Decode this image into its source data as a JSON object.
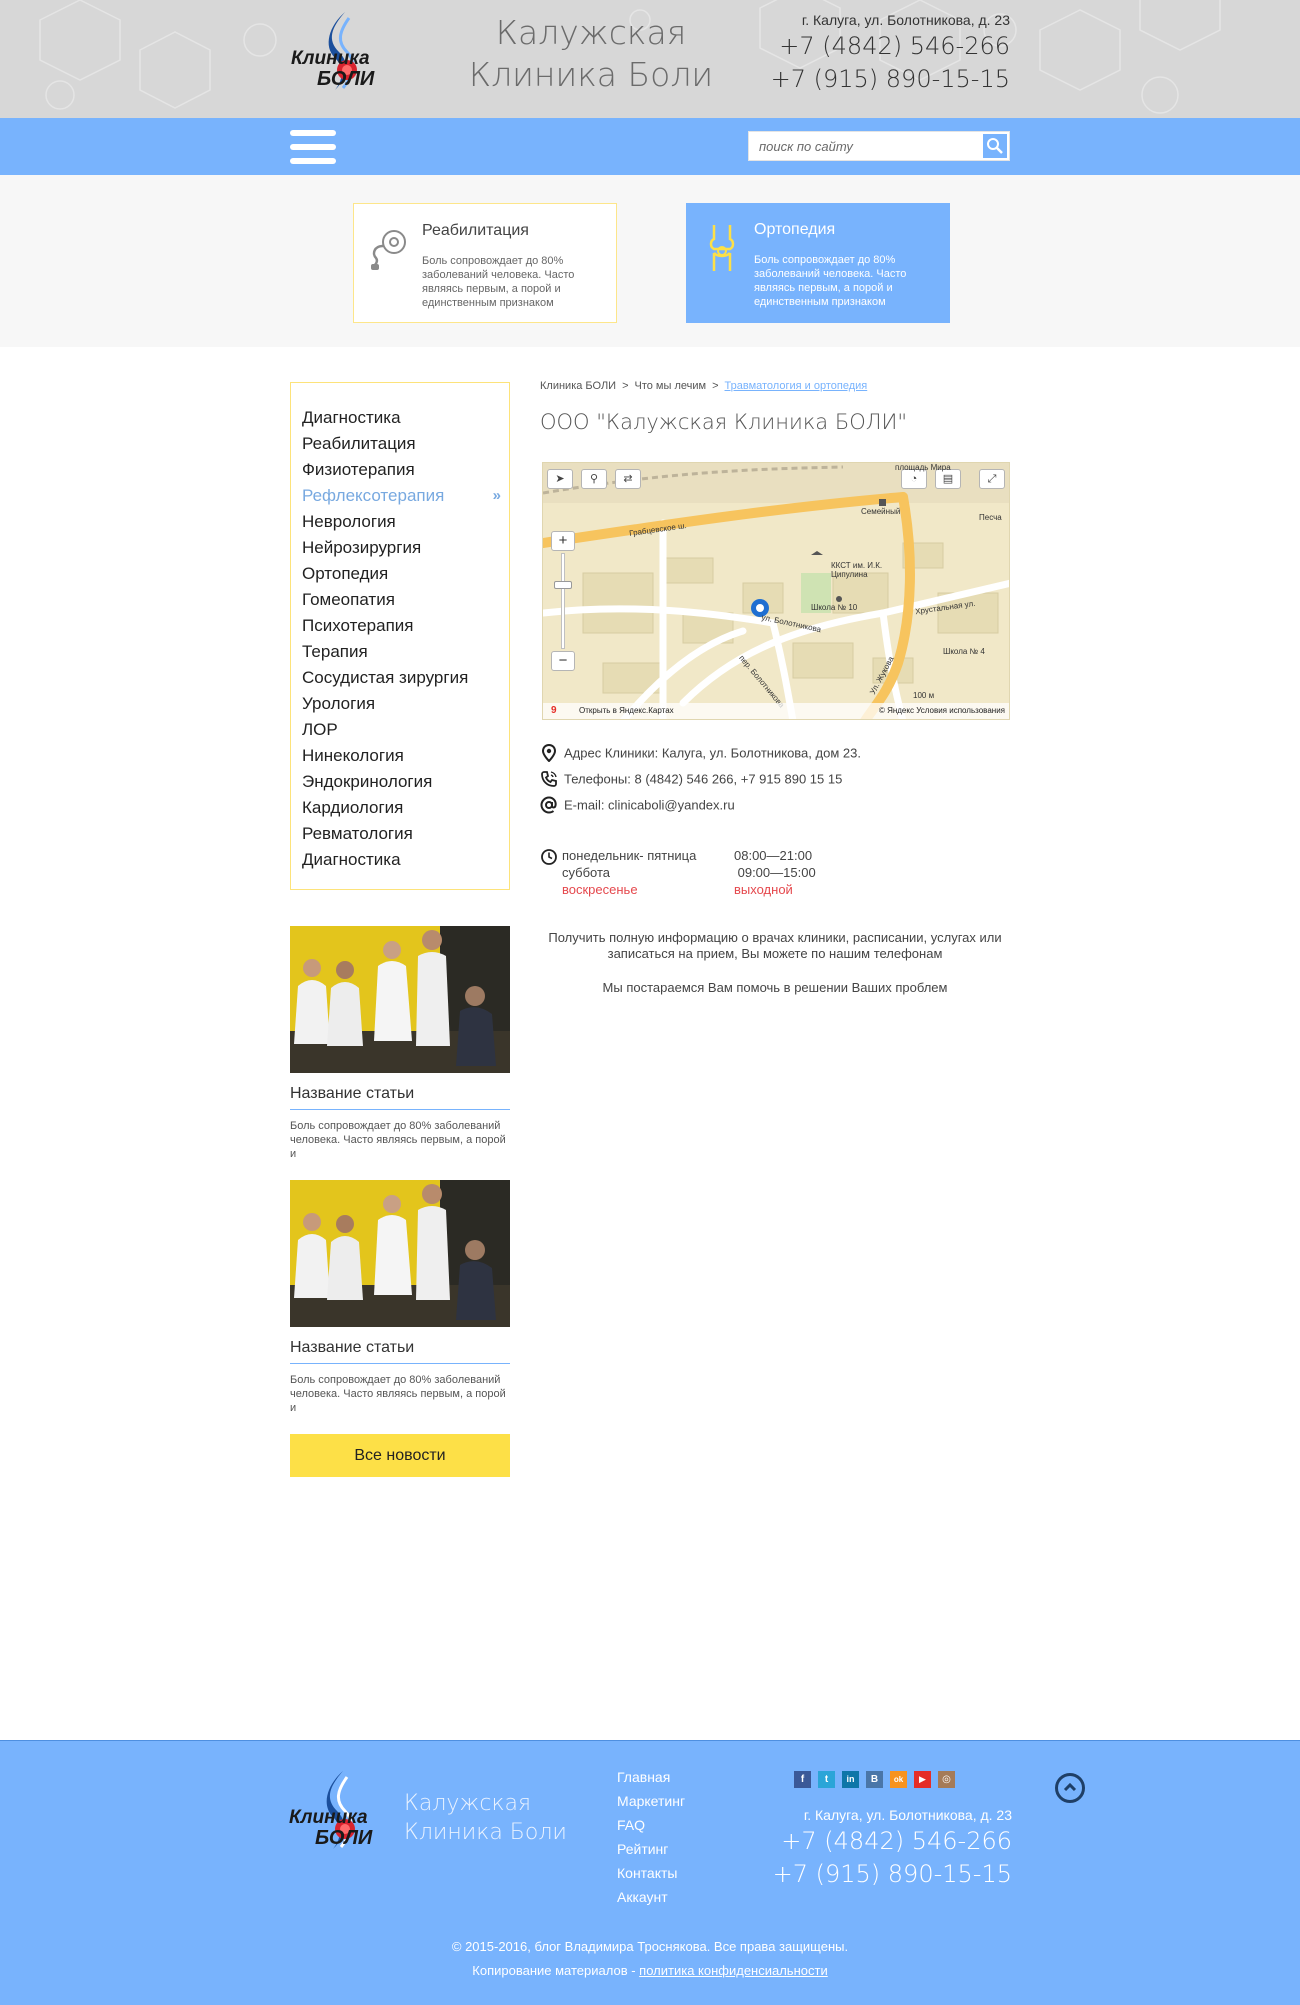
{
  "brand": {
    "logo_line1": "Клиника",
    "logo_line2": "БОЛИ",
    "title_line1": "Калужская",
    "title_line2": "Клиника Боли"
  },
  "header": {
    "address": "г. Калуга, ул. Болотникова, д. 23",
    "phone1": "+7 (4842) 546-266",
    "phone2": "+7 (915) 890-15-15"
  },
  "nav": {
    "menu_icon": "hamburger-icon",
    "search_placeholder": "поиск по сайту",
    "search_icon": "search-icon"
  },
  "features": [
    {
      "title": "Реабилитация",
      "text": "Боль сопровождает до 80% заболеваний человека. Часто являясь первым, а порой и единственным признаком",
      "icon": "tonometer-icon"
    },
    {
      "title": "Ортопедия",
      "text": "Боль сопровождает до 80% заболеваний человека. Часто являясь первым, а порой и единственным признаком",
      "icon": "knee-joint-icon"
    }
  ],
  "sidebar": {
    "items": [
      {
        "label": "Диагностика"
      },
      {
        "label": "Реабилитация"
      },
      {
        "label": "Физиотерапия"
      },
      {
        "label": "Рефлексотерапия",
        "active": true,
        "arrow": "»"
      },
      {
        "label": "Неврология"
      },
      {
        "label": "Нейрозирургия"
      },
      {
        "label": "Ортопедия"
      },
      {
        "label": "Гомеопатия"
      },
      {
        "label": "Психотерапия"
      },
      {
        "label": "Терапия"
      },
      {
        "label": "Сосудистая зирургия"
      },
      {
        "label": "Урология"
      },
      {
        "label": "ЛОР"
      },
      {
        "label": "Нинекология"
      },
      {
        "label": "Эндокринология"
      },
      {
        "label": "Кардиология"
      },
      {
        "label": "Ревматология"
      },
      {
        "label": "Диагностика"
      }
    ],
    "articles": [
      {
        "title": "Название статьи",
        "text": "Боль сопровождает до 80% заболеваний человека. Часто являясь первым, а порой и"
      },
      {
        "title": "Название статьи",
        "text": "Боль сопровождает до 80% заболеваний человека. Часто являясь первым, а порой и"
      }
    ],
    "news_button": "Все новости"
  },
  "breadcrumb": {
    "items": [
      "Клиника БОЛИ",
      "Что мы лечим",
      "Травматология и ортопедия"
    ],
    "separator": ">"
  },
  "page_title": "ООО \"Калужская Клиника БОЛИ\"",
  "map": {
    "labels": {
      "street1": "Грабцевское ш.",
      "street2": "ул. Болотникова",
      "street3": "Хрустальная ул.",
      "street4": "Ул. Жукова",
      "street5": "пер. Болотникова",
      "place1": "Семейный",
      "place2": "ККСТ им. И.К. Ципулина",
      "place3": "Школа № 10",
      "place4": "Школа № 4",
      "place5": "площадь Мира",
      "place6": "Песча"
    },
    "open_link": "Открыть в Яндекс.Картах",
    "copyright": "© Яндекс Условия использования",
    "scale": "100 м",
    "zoom_in": "+",
    "zoom_out": "−"
  },
  "contact_info": {
    "address": "Адрес Клиники: Калуга, ул. Болотникова, дом 23.",
    "phones": "Телефоны: 8 (4842) 546 266, +7 915 890 15 15",
    "email": "E-mail: clinicaboli@yandex.ru"
  },
  "schedule": [
    {
      "day": "понедельник- пятница",
      "time": "08:00—21:00",
      "off": false
    },
    {
      "day": "суббота",
      "time": " 09:00—15:00",
      "off": false
    },
    {
      "day": "воскресенье",
      "time": "выходной",
      "off": true
    }
  ],
  "notes": {
    "info": "Получить полную информацию о врачах клиники, расписании, услугах или записаться на прием, Вы можете по нашим телефонам",
    "help": "Мы постараемся Вам помочь в решении Ваших проблем"
  },
  "footer": {
    "links": [
      "Главная",
      "Маркетинг",
      "FAQ",
      "Рейтинг",
      "Контакты",
      "Аккаунт"
    ],
    "socials": [
      {
        "icon": "facebook-icon",
        "glyph": "f",
        "color": "#3b5998"
      },
      {
        "icon": "twitter-icon",
        "glyph": "t",
        "color": "#2ba5d8"
      },
      {
        "icon": "linkedin-icon",
        "glyph": "in",
        "color": "#0e76a8"
      },
      {
        "icon": "vkontakte-icon",
        "glyph": "B",
        "color": "#4a76a8"
      },
      {
        "icon": "odnoklassniki-icon",
        "glyph": "ok",
        "color": "#f7931e"
      },
      {
        "icon": "youtube-icon",
        "glyph": "▶",
        "color": "#e52d27"
      },
      {
        "icon": "instagram-icon",
        "glyph": "◎",
        "color": "#a57b58"
      }
    ],
    "address": "г. Калуга, ул. Болотникова, д. 23",
    "phone1": "+7 (4842) 546-266",
    "phone2": "+7 (915) 890-15-15",
    "copyright": "© 2015-2016, блог Владимира Троснякова. Все права защищены.",
    "copy_prefix": "Копирование материалов - ",
    "policy_link": "политика конфиденсиальности",
    "to_top_icon": "arrow-up-circle-icon"
  },
  "colors": {
    "accent_blue": "#78b3fd",
    "accent_yellow": "#fde047",
    "off_day_red": "#e5484d"
  }
}
